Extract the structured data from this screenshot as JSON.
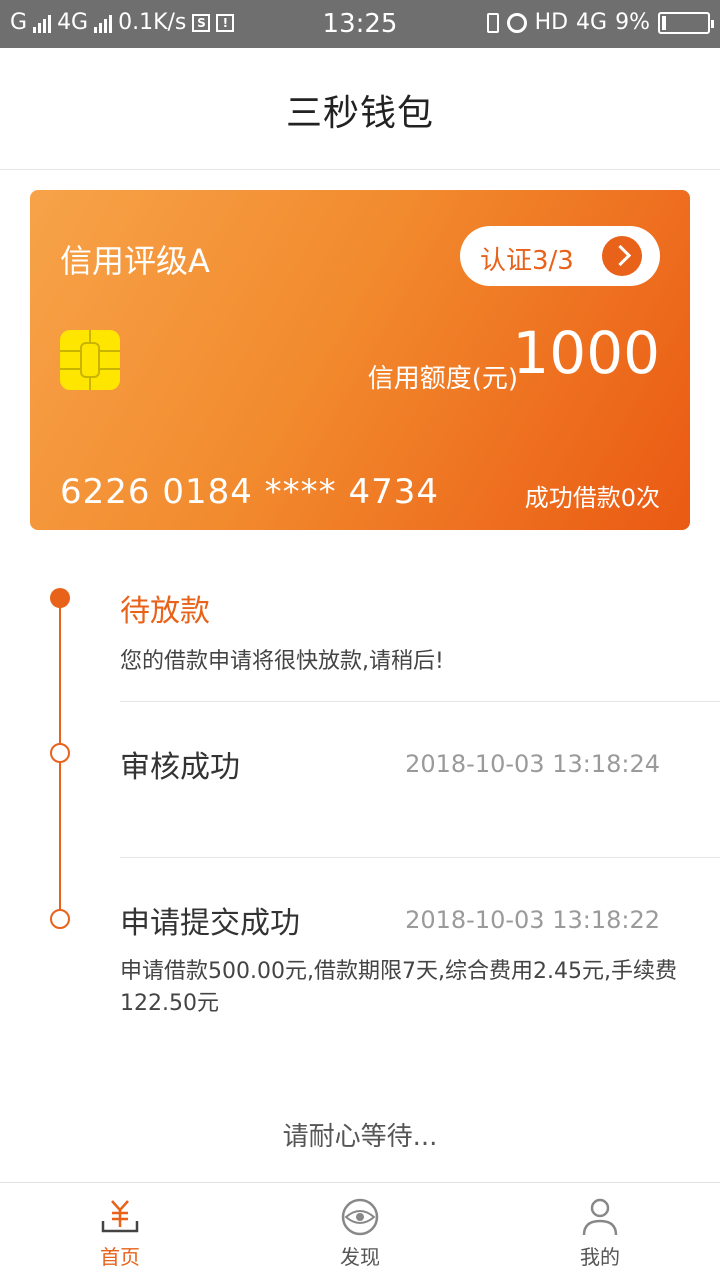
{
  "status_bar": {
    "carrier1": "G",
    "carrier2": "4G",
    "speed": "0.1K/s",
    "time": "13:25",
    "hd": "HD",
    "net": "4G",
    "battery_pct_text": "9%",
    "battery_level": 0.09
  },
  "header": {
    "title": "三秒钱包"
  },
  "card": {
    "rating": "信用评级A",
    "verify_label": "认证3/3",
    "limit_label": "信用额度(元)",
    "limit_value": "1000",
    "number": "6226 0184 **** 4734",
    "loan_count": "成功借款0次",
    "gradient_start": "#f7a349",
    "gradient_end": "#ea5a13",
    "chip_color": "#ffe600"
  },
  "timeline": {
    "accent": "#e8621a",
    "steps": [
      {
        "title": "待放款",
        "desc": "您的借款申请将很快放款,请稍后!",
        "time": ""
      },
      {
        "title": "审核成功",
        "desc": "",
        "time": "2018-10-03 13:18:24"
      },
      {
        "title": "申请提交成功",
        "desc": "申请借款500.00元,借款期限7天,综合费用2.45元,手续费122.50元",
        "time": "2018-10-03 13:18:22"
      }
    ]
  },
  "waiting_text": "请耐心等待...",
  "bottom_nav": {
    "items": [
      {
        "label": "首页",
        "icon": "yuan-wallet-icon",
        "active": true
      },
      {
        "label": "发现",
        "icon": "eye-icon",
        "active": false
      },
      {
        "label": "我的",
        "icon": "user-icon",
        "active": false
      }
    ]
  }
}
